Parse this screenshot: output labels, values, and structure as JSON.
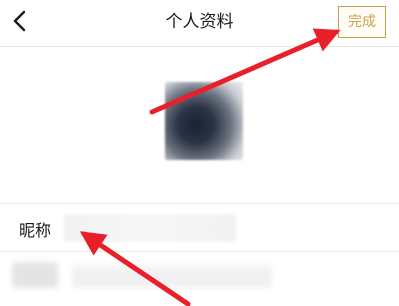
{
  "header": {
    "back_icon": "chevron-left-icon",
    "title": "个人资料",
    "done_label": "完成"
  },
  "profile": {
    "avatar": "avatar-image",
    "nickname_label": "昵称"
  },
  "colors": {
    "accent": "#c8a24b",
    "annotation_arrow": "#e8202a",
    "divider": "#e6e6e6"
  }
}
